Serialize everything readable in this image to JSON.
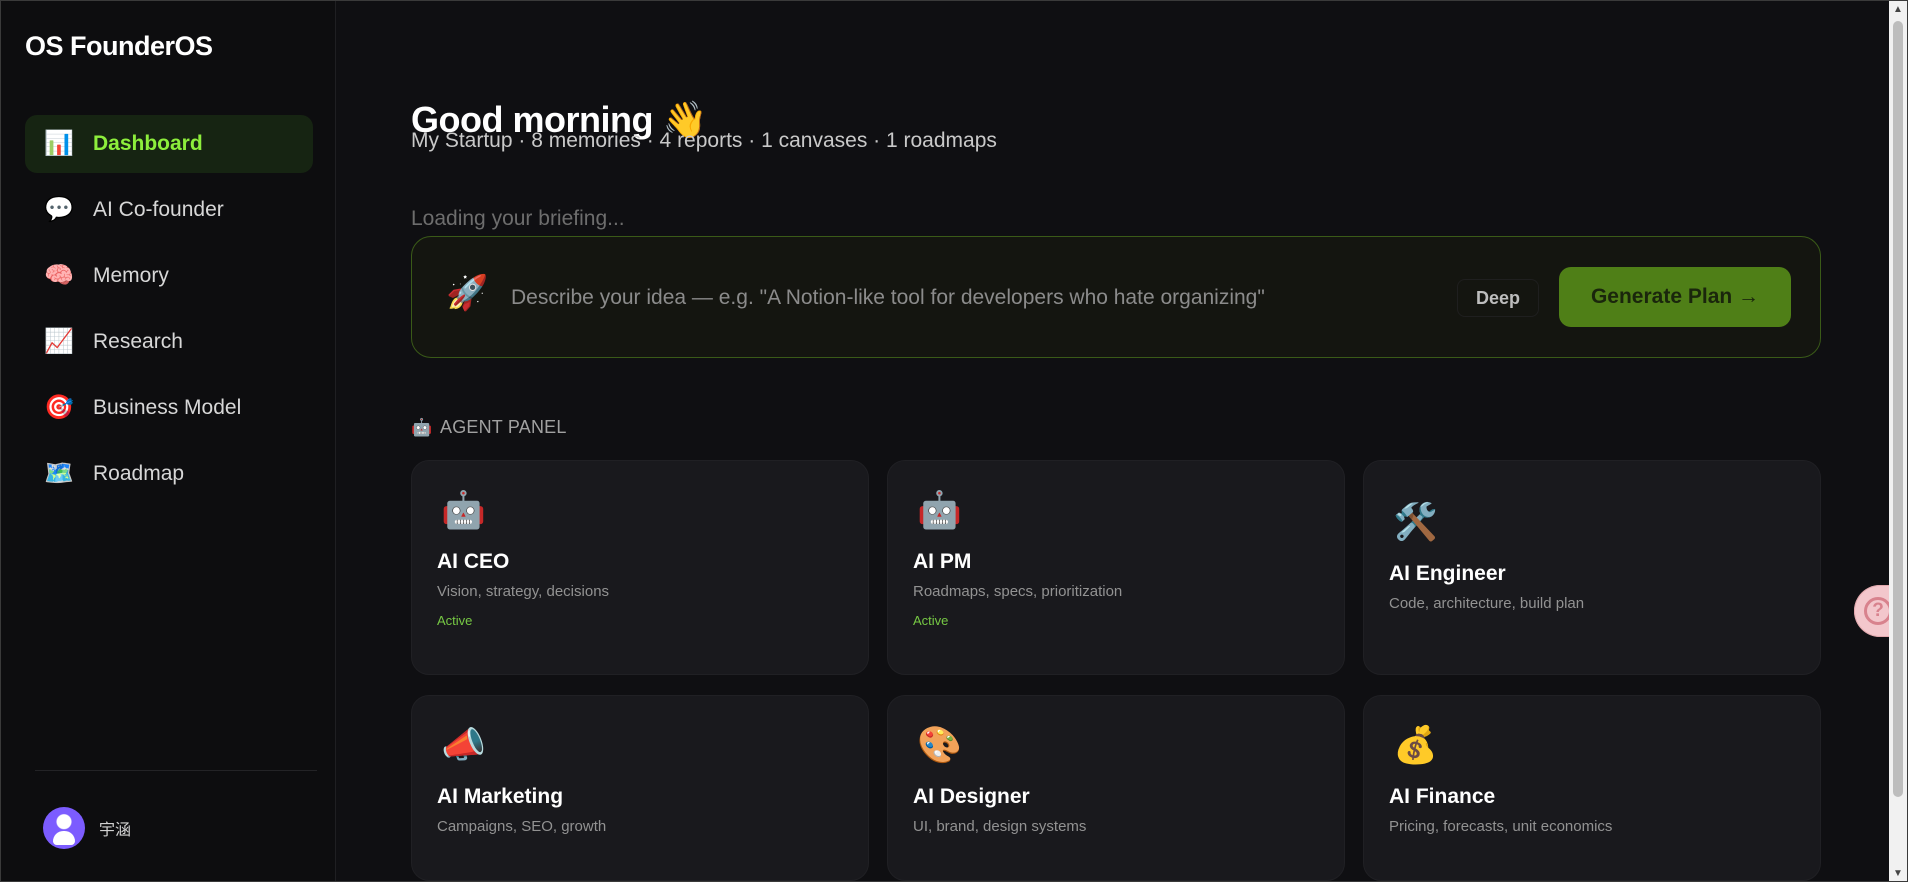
{
  "brand": {
    "title": "OS FounderOS"
  },
  "sidebar": {
    "items": [
      {
        "label": "Dashboard",
        "icon": "bar-chart-icon",
        "glyph": "📊"
      },
      {
        "label": "AI Co-founder",
        "icon": "speech-bubble-icon",
        "glyph": "💬"
      },
      {
        "label": "Memory",
        "icon": "brain-icon",
        "glyph": "🧠"
      },
      {
        "label": "Research",
        "icon": "trend-chart-icon",
        "glyph": "📈"
      },
      {
        "label": "Business Model",
        "icon": "target-icon",
        "glyph": "🎯"
      },
      {
        "label": "Roadmap",
        "icon": "map-icon",
        "glyph": "🗺️"
      }
    ]
  },
  "user": {
    "name": "宇涵"
  },
  "main": {
    "greeting": "Good morning 👋",
    "summary": "My Startup · 8 memories · 4 reports · 1 canvases · 1 roadmaps",
    "briefing": "Loading your briefing...",
    "idea": {
      "icon": "rocket-icon",
      "glyph": "🚀",
      "placeholder": "Describe your idea — e.g. \"A Notion-like tool for developers who hate organizing\"",
      "deep_label": "Deep",
      "generate_label": "Generate Plan →"
    },
    "agent_panel": {
      "title": "AGENT PANEL",
      "icon": "robot-icon",
      "glyph": "🤖",
      "agents": [
        {
          "name": "AI CEO",
          "description": "Vision, strategy, decisions",
          "status": "Active",
          "icon": "robot-icon",
          "glyph": "🤖"
        },
        {
          "name": "AI PM",
          "description": "Roadmaps, specs, prioritization",
          "status": "Active",
          "icon": "robot-icon",
          "glyph": "🤖"
        },
        {
          "name": "AI Engineer",
          "description": "Code, architecture, build plan",
          "status": "",
          "icon": "tools-icon",
          "glyph": "🛠️"
        },
        {
          "name": "AI Marketing",
          "description": "Campaigns, SEO, growth",
          "status": "",
          "icon": "megaphone-icon",
          "glyph": "📣"
        },
        {
          "name": "AI Designer",
          "description": "UI, brand, design systems",
          "status": "",
          "icon": "palette-icon",
          "glyph": "🎨"
        },
        {
          "name": "AI Finance",
          "description": "Pricing, forecasts, unit economics",
          "status": "",
          "icon": "money-bag-icon",
          "glyph": "💰"
        }
      ]
    }
  },
  "colors": {
    "accent_green": "#8dee3c",
    "button_green": "#4f7f17",
    "background": "#0f0f12",
    "card": "#19191d"
  }
}
